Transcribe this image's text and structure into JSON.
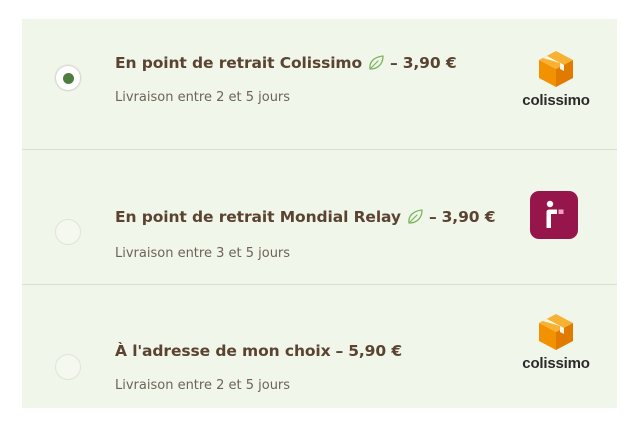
{
  "options": [
    {
      "selected": true,
      "name": "En point de retrait Colissimo",
      "eco": true,
      "separator": "–",
      "price": "3,90 €",
      "delivery": "Livraison entre 2 et 5 jours",
      "carrier_icon": "colissimo-logo",
      "carrier_wordmark": "colissimo"
    },
    {
      "selected": false,
      "name": "En point de retrait Mondial Relay",
      "eco": true,
      "separator": "–",
      "price": "3,90 €",
      "delivery": "Livraison entre 3 et 5 jours",
      "carrier_icon": "mondial-relay-logo"
    },
    {
      "selected": false,
      "name": "À l'adresse de mon choix",
      "eco": false,
      "separator": "–",
      "price": "5,90 €",
      "delivery": "Livraison entre 2 et 5 jours",
      "carrier_icon": "colissimo-logo",
      "carrier_wordmark": "colissimo"
    }
  ],
  "colors": {
    "panel_background": "#f1f6ea",
    "title_text": "#5b4331",
    "radio_selected": "#4f7d3f",
    "eco_leaf": "#7bb65f",
    "colissimo_orange": "#f29200",
    "mondial_relay": "#96154a"
  }
}
